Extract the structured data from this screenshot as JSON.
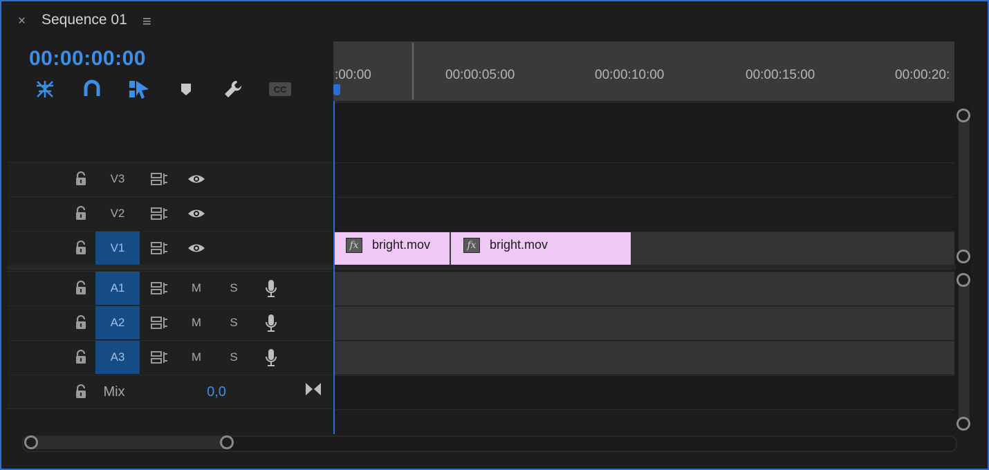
{
  "panel": {
    "title": "Sequence 01",
    "close_glyph": "×",
    "menu_glyph": "≡",
    "timecode": "00:00:00:00"
  },
  "toolbar": [
    {
      "name": "insert-overwrite-sequence-icon",
      "active": true
    },
    {
      "name": "snap-magnet-icon",
      "active": true
    },
    {
      "name": "linked-selection-icon",
      "active": true
    },
    {
      "name": "add-marker-icon",
      "active": false
    },
    {
      "name": "timeline-settings-wrench-icon",
      "active": false
    },
    {
      "name": "captions-cc-icon",
      "active": false
    }
  ],
  "ruler": {
    "labels": [
      ":00:00",
      "00:00:05:00",
      "00:00:10:00",
      "00:00:15:00",
      "00:00:20:"
    ]
  },
  "tracks": {
    "video": [
      {
        "id": "V3",
        "targeted": false
      },
      {
        "id": "V2",
        "targeted": false
      },
      {
        "id": "V1",
        "targeted": true
      }
    ],
    "audio": [
      {
        "id": "A1",
        "targeted": true,
        "mute": "M",
        "solo": "S"
      },
      {
        "id": "A2",
        "targeted": true,
        "mute": "M",
        "solo": "S"
      },
      {
        "id": "A3",
        "targeted": true,
        "mute": "M",
        "solo": "S"
      }
    ],
    "mix": {
      "label": "Mix",
      "value": "0,0"
    }
  },
  "clips": [
    {
      "name": "bright.mov",
      "fx": "fx",
      "track": "V1"
    },
    {
      "name": "bright.mov",
      "fx": "fx",
      "track": "V1"
    }
  ],
  "colors": {
    "accent": "#2d6bd5",
    "timecode": "#3b8fea",
    "clip": "#f0c8f5",
    "target_track": "#154c86"
  }
}
